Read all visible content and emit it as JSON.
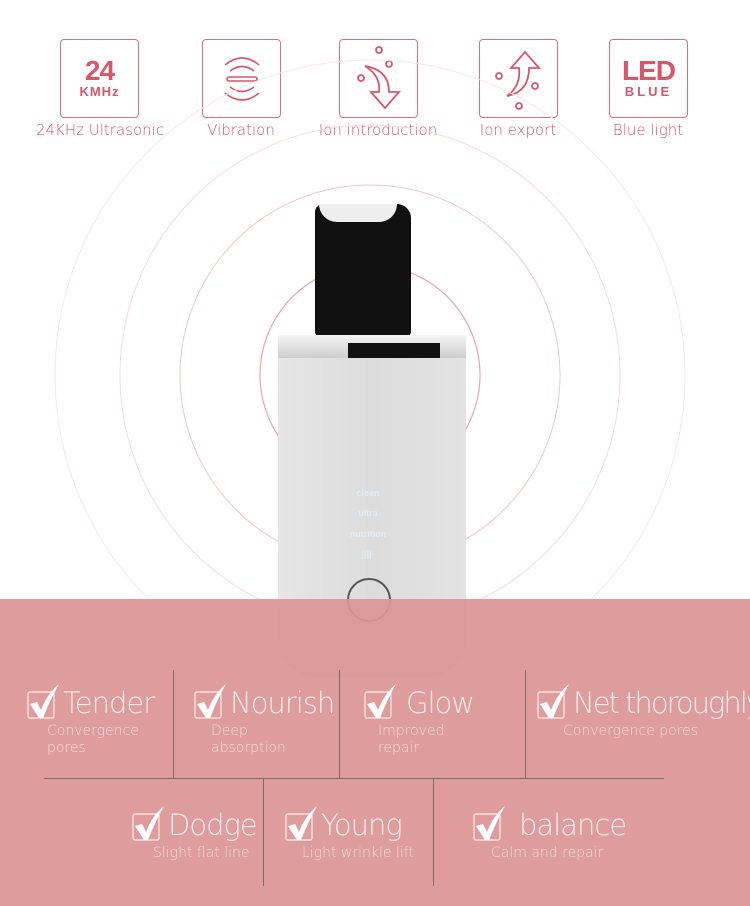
{
  "features_top": [
    {
      "icon": "24khz-icon",
      "big": "24",
      "small": "KMHz",
      "label": "24KHz Ultrasonic"
    },
    {
      "icon": "vibration-icon",
      "label": "Vibration"
    },
    {
      "icon": "ion-introduction-icon",
      "label": "Ion introduction"
    },
    {
      "icon": "ion-export-icon",
      "label": "Ion export"
    },
    {
      "icon": "led-blue-icon",
      "big": "LED",
      "small": "BLUE",
      "label": "Blue light"
    }
  ],
  "device": {
    "modes": [
      "clean",
      "ultra",
      "nutrition",
      "||||·"
    ]
  },
  "benefits": [
    {
      "title": "Tender",
      "sub": "Convergence pores"
    },
    {
      "title": "Nourish",
      "sub": "Deep absorption"
    },
    {
      "title": "Glow",
      "sub": "Improved repair"
    },
    {
      "title": "Net thoroughly",
      "sub": "Convergence pores"
    },
    {
      "title": "Dodge",
      "sub": "Slight flat line"
    },
    {
      "title": "Young",
      "sub": "Light wrinkle lift"
    },
    {
      "title": "balance",
      "sub": "Calm and repair"
    }
  ],
  "colors": {
    "accent": "#d9566a",
    "band": "#df9d9d"
  }
}
